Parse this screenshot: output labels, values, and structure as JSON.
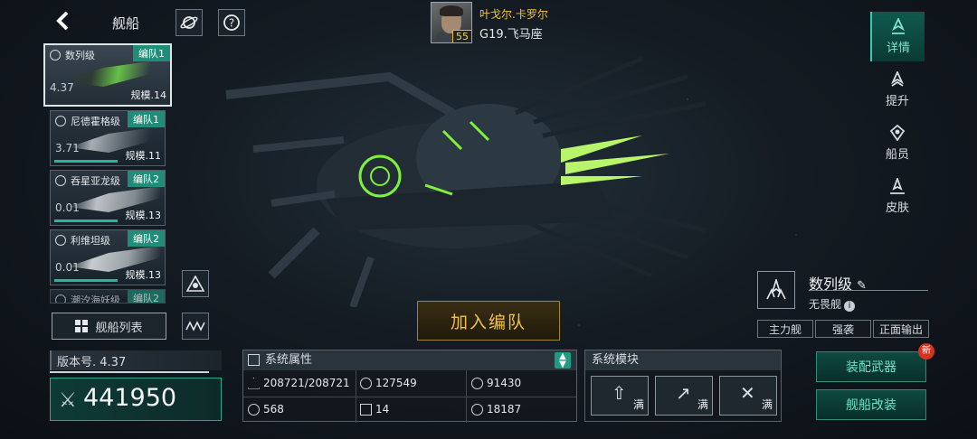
{
  "header": {
    "back_icon": "chevron-left-icon",
    "title": "舰船",
    "planet_icon": "planet-icon",
    "help_icon": "question-mark-icon"
  },
  "commander": {
    "name": "叶戈尔.卡罗尔",
    "level": "55",
    "location": "G19.飞马座"
  },
  "ship_list": [
    {
      "name": "数列级",
      "fleet": "编队1",
      "value": "4.37",
      "scale": "规模.14",
      "active": true
    },
    {
      "name": "尼德霍格级",
      "fleet": "编队1",
      "value": "3.71",
      "scale": "规模.11"
    },
    {
      "name": "吞星亚龙级",
      "fleet": "编队2",
      "value": "0.01",
      "scale": "规模.13"
    },
    {
      "name": "利维坦级",
      "fleet": "编队2",
      "value": "0.01",
      "scale": "规模.13"
    },
    {
      "name": "潮汐海妖级",
      "fleet": "编队2"
    }
  ],
  "list_button": "舰船列表",
  "version": {
    "label": "版本号. 4.37"
  },
  "power": {
    "value": "441950"
  },
  "join_button": "加入编队",
  "right_tabs": [
    {
      "label": "详情",
      "active": true
    },
    {
      "label": "提升"
    },
    {
      "label": "船员"
    },
    {
      "label": "皮肤"
    }
  ],
  "ship_info": {
    "class_name": "数列级",
    "type": "无畏舰",
    "tags": [
      "主力舰",
      "强袭",
      "正面输出"
    ]
  },
  "system_attrs": {
    "title": "系统属性",
    "stats": [
      {
        "value": "208721/208721"
      },
      {
        "value": "127549"
      },
      {
        "value": "91430"
      },
      {
        "value": "568"
      },
      {
        "value": "14"
      },
      {
        "value": "18187"
      }
    ]
  },
  "system_modules": {
    "title": "系统模块",
    "modules": [
      {
        "status": "满"
      },
      {
        "status": "满"
      },
      {
        "status": "满"
      }
    ]
  },
  "actions": {
    "equip": "装配武器",
    "modify": "舰船改装",
    "new_badge": "新"
  },
  "colors": {
    "accent_teal": "#1f8d78",
    "gold": "#f0c24a",
    "new_red": "#d2341f"
  }
}
